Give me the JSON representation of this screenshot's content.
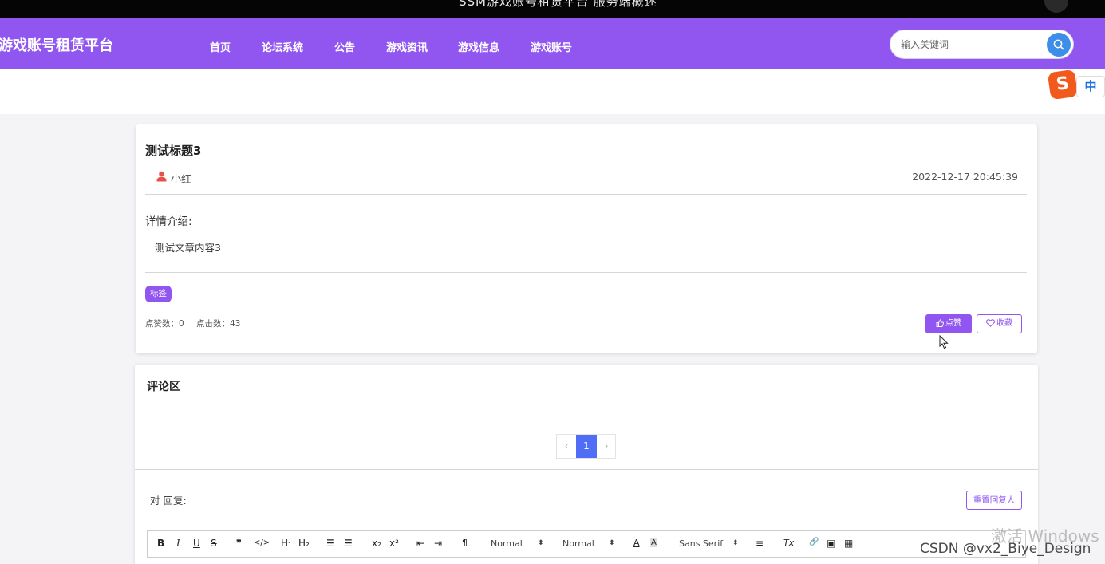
{
  "top_banner": {
    "text": "SSM游戏账号租赁平台 服务端概述"
  },
  "navbar": {
    "brand": "游戏账号租赁平台",
    "items": [
      {
        "label": "首页"
      },
      {
        "label": "论坛系统"
      },
      {
        "label": "公告"
      },
      {
        "label": "游戏资讯"
      },
      {
        "label": "游戏信息"
      },
      {
        "label": "游戏账号"
      }
    ],
    "search": {
      "placeholder": "输入关键词",
      "value": ""
    }
  },
  "ime": {
    "logo": "S",
    "mode": "中"
  },
  "article": {
    "title": "测试标题3",
    "author": "小红",
    "date": "2022-12-17 20:45:39",
    "detail_label": "详情介绍:",
    "content": "测试文章内容3",
    "tag": "标签",
    "likes_label": "点赞数：0",
    "clicks_label": "点击数：43",
    "like_button": "点赞",
    "favorite_button": "收藏"
  },
  "comments": {
    "title": "评论区",
    "pagination": {
      "prev": "‹",
      "current_page": "1",
      "next": "›"
    },
    "reply_label": "对 回复:",
    "reset_button": "重置回复人"
  },
  "editor": {
    "toolbar": {
      "bold": "B",
      "italic": "I",
      "underline": "U",
      "strike": "S",
      "blockquote": "❞",
      "code": "</>",
      "h1": "H₁",
      "h2": "H₂",
      "ordered_list": "☰",
      "bullet_list": "☰",
      "subscript": "x₂",
      "superscript": "x²",
      "indent_minus": "⇤",
      "indent_plus": "⇥",
      "direction": "¶",
      "size_select": "Normal",
      "header_select": "Normal",
      "font_color": "A",
      "background_color": "A",
      "font_select": "Sans Serif",
      "align": "≡",
      "clean": "Tx",
      "link": "🔗",
      "image": "▣",
      "video": "▦"
    }
  },
  "watermarks": {
    "windows": "激活 Windows",
    "csdn": "CSDN @vx2_Biye_Design"
  },
  "colors": {
    "accent": "#9155f0",
    "pagination_active": "#4f6df5",
    "search_button": "#3d8ee8",
    "author_icon": "#e8514a"
  }
}
